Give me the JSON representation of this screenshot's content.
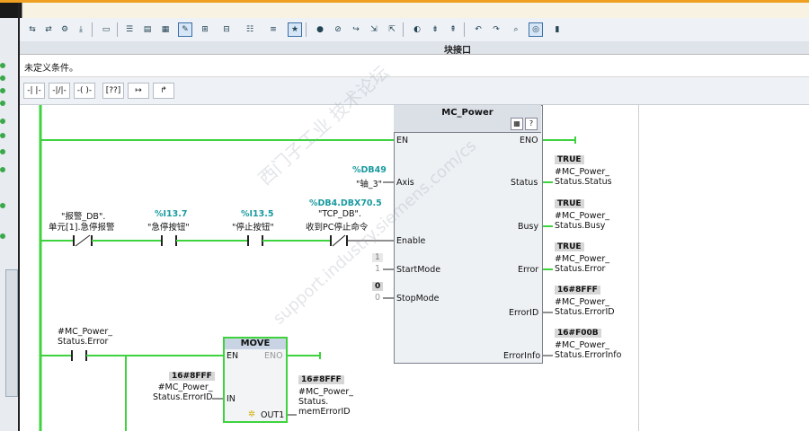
{
  "panel_title": "块接口",
  "condition_text": "未定义条件。",
  "ladder_buttons": [
    "-| |-",
    "-|/|-",
    "-( )-",
    "[??]",
    "↦",
    "↱"
  ],
  "toolbar_icons": [
    "go-online-icon",
    "go-offline-icon",
    "compile-icon",
    "download-icon",
    "insert-network-icon",
    "network-view-icon",
    "block-view-icon",
    "comments-icon",
    "open-all-icon",
    "close-all-icon",
    "addresses-icon",
    "absolute-operand-icon",
    "favorites-icon",
    "remove-breakpoint-icon",
    "disable-icon",
    "step-icon",
    "next-icon",
    "back-icon",
    "monitor-icon",
    "watch-icon",
    "force-icon",
    "glasses-icon",
    "clear-icon"
  ],
  "rung1": {
    "contacts": [
      {
        "name_line1": "\"报警_DB\".",
        "name_line2": "单元[1].急停报警",
        "address": ""
      },
      {
        "name_line1": "\"急停按钮\"",
        "name_line2": "",
        "address": "%I13.7"
      },
      {
        "name_line1": "\"停止按钮\"",
        "name_line2": "",
        "address": "%I13.5"
      },
      {
        "name_line1": "\"TCP_DB\".",
        "name_line2": "收到PC停止命令",
        "address": "%DB4.DBX70.5"
      }
    ],
    "block": {
      "title": "MC_Power",
      "inputs": [
        "EN",
        "Axis",
        "Enable",
        "StartMode",
        "StopMode"
      ],
      "outputs": [
        "ENO",
        "Status",
        "Busy",
        "Error",
        "ErrorID",
        "ErrorInfo"
      ],
      "axis_address": "%DB49",
      "axis_name": "\"轴_3\"",
      "startmode_value": "1",
      "stopmode_value": "0",
      "startmode_live": "1",
      "stopmode_live": "0",
      "output_values": [
        {
          "value": "TRUE",
          "line1": "#MC_Power_",
          "line2": "Status.Status"
        },
        {
          "value": "TRUE",
          "line1": "#MC_Power_",
          "line2": "Status.Busy"
        },
        {
          "value": "TRUE",
          "line1": "#MC_Power_",
          "line2": "Status.Error"
        },
        {
          "value": "16#8FFF",
          "line1": "#MC_Power_",
          "line2": "Status.ErrorID"
        },
        {
          "value": "16#F00B",
          "line1": "#MC_Power_",
          "line2": "Status.ErrorInfo"
        }
      ]
    }
  },
  "rung2": {
    "contact": {
      "line1": "#MC_Power_",
      "line2": "Status.Error"
    },
    "block": {
      "title": "MOVE",
      "en": "EN",
      "eno": "ENO",
      "in": "IN",
      "out": "OUT1",
      "in_value": "16#8FFF",
      "in_line1": "#MC_Power_",
      "in_line2": "Status.ErrorID",
      "out_value": "16#8FFF",
      "out_line1": "#MC_Power_",
      "out_line2": "Status.",
      "out_line3": "memErrorID"
    }
  },
  "watermark": {
    "line1": "西门子工业  技术论坛",
    "line2": "support.industry.siemens.com/cs"
  },
  "colors": {
    "powerflow": "#3ed33e",
    "address": "#1a9aa0",
    "accent": "#f0a020"
  }
}
